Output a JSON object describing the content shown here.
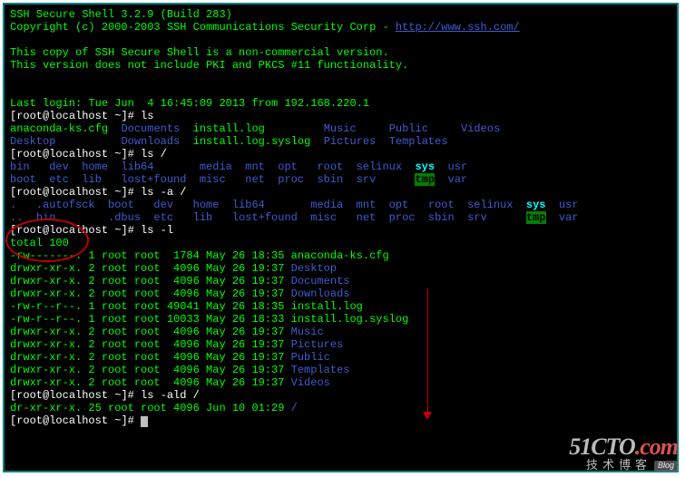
{
  "header": {
    "line1": "SSH Secure Shell 3.2.9 (Build 283)",
    "line2_prefix": "Copyright (c) 2000-2003 SSH Communications Security Corp - ",
    "line2_url": "http://www.ssh.com/",
    "notice1": "This copy of SSH Secure Shell is a non-commercial version.",
    "notice2": "This version does not include PKI and PKCS #11 functionality."
  },
  "last_login": "Last login: Tue Jun  4 16:45:09 2013 from 192.168.220.1",
  "prompts": {
    "user_host": "root@localhost",
    "path": "~",
    "bracket_open": "[",
    "bracket_close": "]#"
  },
  "commands": {
    "ls": "ls",
    "ls_root": "ls /",
    "ls_a_root": "ls -a /",
    "ls_l": "ls -l",
    "ls_ald_root": "ls -ald /"
  },
  "ls_home": {
    "row1": {
      "c1": "anaconda-ks.cfg",
      "c2": "Documents",
      "c3": "install.log",
      "c4": "Music",
      "c5": "Public",
      "c6": "Videos"
    },
    "row2": {
      "c1": "Desktop",
      "c2": "Downloads",
      "c3": "install.log.syslog",
      "c4": "Pictures",
      "c5": "Templates"
    }
  },
  "ls_root": {
    "row1": "bin   dev  home  lib64       media  mnt  opt   root  selinux  ",
    "row1_sys": "sys",
    "row1_end": "  usr",
    "row2": "boot  etc  lib   lost+found  misc   net  proc  sbin  srv      ",
    "row2_tmp": "tmp",
    "row2_end": "  var"
  },
  "ls_a_root": {
    "row1_a": ".   .autofsck  boot   dev   home  lib64       media  mnt  opt   root  selinux  ",
    "row1_sys": "sys",
    "row1_end": "  usr",
    "row2_a": "..",
    "row2_b": "  bin        .dbus  etc   lib   lost+found  misc   net  proc  sbin  srv      ",
    "row2_tmp": "tmp",
    "row2_end": "  var"
  },
  "ls_l": {
    "total": "total 100",
    "rows": [
      {
        "perm": "-rw-------.",
        "links": "1",
        "owner": "root",
        "group": "root",
        "size": "1784",
        "date": "May 26 18:35",
        "name": "anaconda-ks.cfg",
        "color": "green"
      },
      {
        "perm": "drwxr-xr-x.",
        "links": "2",
        "owner": "root",
        "group": "root",
        "size": "4096",
        "date": "May 26 19:37",
        "name": "Desktop",
        "color": "blue"
      },
      {
        "perm": "drwxr-xr-x.",
        "links": "2",
        "owner": "root",
        "group": "root",
        "size": "4096",
        "date": "May 26 19:37",
        "name": "Documents",
        "color": "blue"
      },
      {
        "perm": "drwxr-xr-x.",
        "links": "2",
        "owner": "root",
        "group": "root",
        "size": "4096",
        "date": "May 26 19:37",
        "name": "Downloads",
        "color": "blue"
      },
      {
        "perm": "-rw-r--r--.",
        "links": "1",
        "owner": "root",
        "group": "root",
        "size": "49041",
        "date": "May 26 18:35",
        "name": "install.log",
        "color": "green"
      },
      {
        "perm": "-rw-r--r--.",
        "links": "1",
        "owner": "root",
        "group": "root",
        "size": "10033",
        "date": "May 26 18:33",
        "name": "install.log.syslog",
        "color": "green"
      },
      {
        "perm": "drwxr-xr-x.",
        "links": "2",
        "owner": "root",
        "group": "root",
        "size": "4096",
        "date": "May 26 19:37",
        "name": "Music",
        "color": "blue"
      },
      {
        "perm": "drwxr-xr-x.",
        "links": "2",
        "owner": "root",
        "group": "root",
        "size": "4096",
        "date": "May 26 19:37",
        "name": "Pictures",
        "color": "blue"
      },
      {
        "perm": "drwxr-xr-x.",
        "links": "2",
        "owner": "root",
        "group": "root",
        "size": "4096",
        "date": "May 26 19:37",
        "name": "Public",
        "color": "blue"
      },
      {
        "perm": "drwxr-xr-x.",
        "links": "2",
        "owner": "root",
        "group": "root",
        "size": "4096",
        "date": "May 26 19:37",
        "name": "Templates",
        "color": "blue"
      },
      {
        "perm": "drwxr-xr-x.",
        "links": "2",
        "owner": "root",
        "group": "root",
        "size": "4096",
        "date": "May 26 19:37",
        "name": "Videos",
        "color": "blue"
      }
    ]
  },
  "ls_ald": {
    "row": "dr-xr-xr-x. 25 root root 4096 Jun 10 01:29 ",
    "name": "/"
  },
  "watermark": {
    "brand_a": "51CTO",
    "brand_b": ".com",
    "sub": "技术博客",
    "tag": "Blog"
  }
}
